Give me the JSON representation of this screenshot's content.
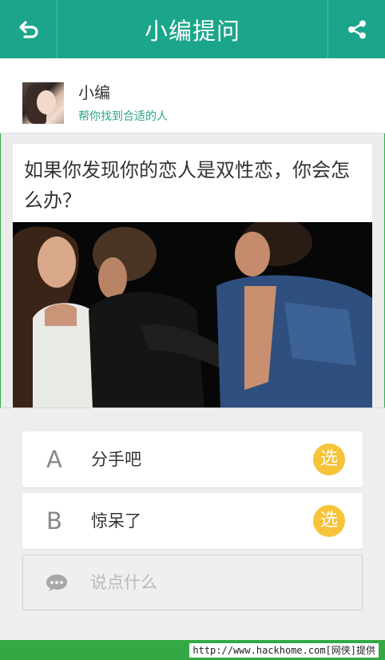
{
  "header": {
    "title": "小编提问",
    "back_icon": "back-arrow-icon",
    "share_icon": "share-icon",
    "color": "#1ba58a"
  },
  "author": {
    "name": "小编",
    "subtitle": "帮你找到合适的人"
  },
  "question": {
    "text": "如果你发现你的恋人是双性恋，你会怎么办？"
  },
  "options": [
    {
      "letter": "A",
      "text": "分手吧",
      "select_label": "选"
    },
    {
      "letter": "B",
      "text": "惊呆了",
      "select_label": "选"
    }
  ],
  "comment": {
    "placeholder": "说点什么",
    "icon": "chat-bubble-icon"
  },
  "footer": {
    "watermark": "http://www.hackhome.com[网侠]提供"
  },
  "colors": {
    "accent": "#1ba58a",
    "select_badge": "#f6c33a",
    "footer": "#33a845"
  }
}
